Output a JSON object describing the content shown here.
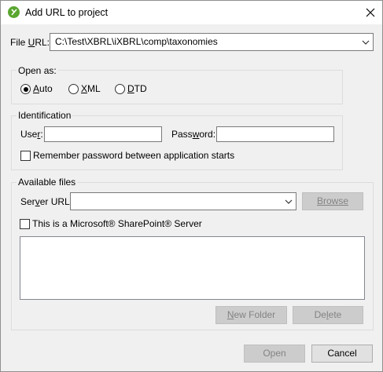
{
  "window": {
    "title": "Add URL to project"
  },
  "file_url": {
    "label": "File URL:",
    "value": "C:\\Test\\XBRL\\iXBRL\\comp\\taxonomies"
  },
  "open_as": {
    "title": "Open as:",
    "options": [
      {
        "label": "Auto",
        "selected": true
      },
      {
        "label": "XML",
        "selected": false
      },
      {
        "label": "DTD",
        "selected": false
      }
    ]
  },
  "identification": {
    "title": "Identification",
    "user_label": "User:",
    "user_value": "",
    "password_label": "Password:",
    "password_value": "",
    "remember_label": "Remember password between application starts",
    "remember_checked": false
  },
  "available_files": {
    "title": "Available files",
    "server_url_label": "Server URL:",
    "server_url_value": "",
    "browse_label": "Browse",
    "sharepoint_label": "This is a Microsoft® SharePoint® Server",
    "sharepoint_checked": false,
    "new_folder_label": "New Folder",
    "delete_label": "Delete"
  },
  "footer": {
    "open_label": "Open",
    "cancel_label": "Cancel"
  }
}
